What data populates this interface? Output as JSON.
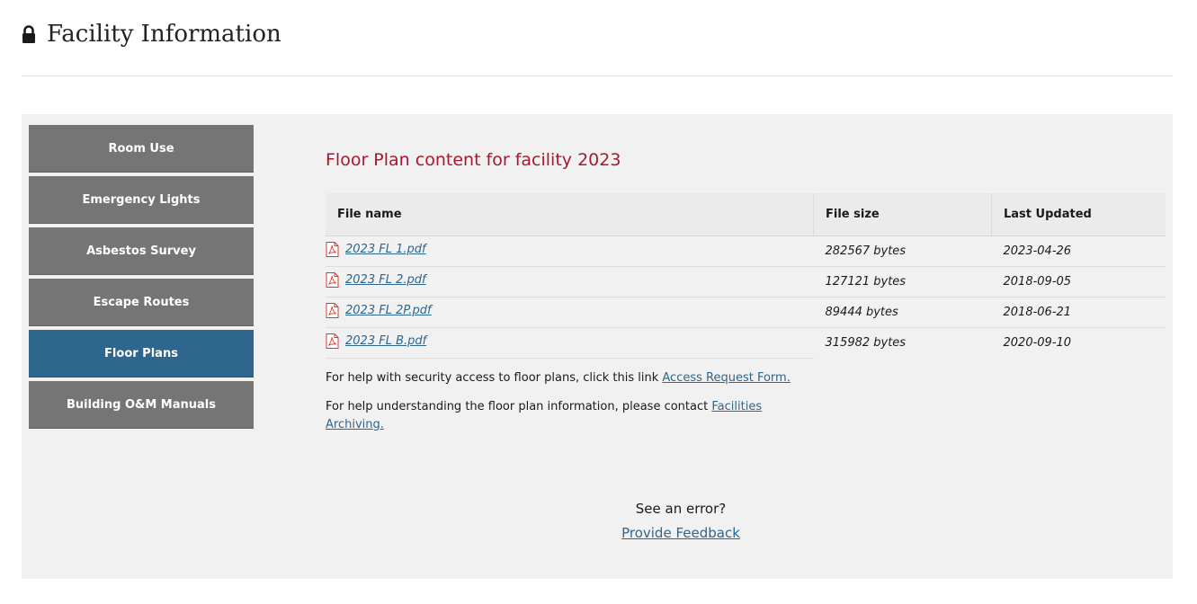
{
  "header": {
    "title": "Facility Information",
    "icon": "lock-icon"
  },
  "sidebar": {
    "items": [
      {
        "label": "Room Use",
        "active": false
      },
      {
        "label": "Emergency Lights",
        "active": false
      },
      {
        "label": "Asbestos Survey",
        "active": false
      },
      {
        "label": "Escape Routes",
        "active": false
      },
      {
        "label": "Floor Plans",
        "active": true
      },
      {
        "label": "Building O&M Manuals",
        "active": false
      }
    ]
  },
  "main": {
    "section_title": "Floor Plan content for facility 2023",
    "table": {
      "headers": [
        "File name",
        "File size",
        "Last Updated"
      ],
      "rows": [
        {
          "name": "2023 FL 1.pdf",
          "size": "282567 bytes",
          "updated": "2023-04-26"
        },
        {
          "name": "2023 FL 2.pdf",
          "size": "127121 bytes",
          "updated": "2018-09-05"
        },
        {
          "name": "2023 FL 2P.pdf",
          "size": "89444 bytes",
          "updated": "2018-06-21"
        },
        {
          "name": "2023 FL B.pdf",
          "size": "315982 bytes",
          "updated": "2020-09-10"
        }
      ]
    },
    "help_security": {
      "text": "For help with security access to floor plans, click this link ",
      "link": "Access Request Form."
    },
    "help_info": {
      "text": "For help understanding the floor plan information, please contact ",
      "link": "Facilities Archiving."
    }
  },
  "feedback": {
    "question": "See an error?",
    "link": "Provide Feedback"
  },
  "colors": {
    "accent_blue": "#2e668e",
    "nav_gray": "#757575",
    "title_red": "#a6192e",
    "panel_bg": "#f1f1f1",
    "pdf_red": "#e0352b"
  }
}
